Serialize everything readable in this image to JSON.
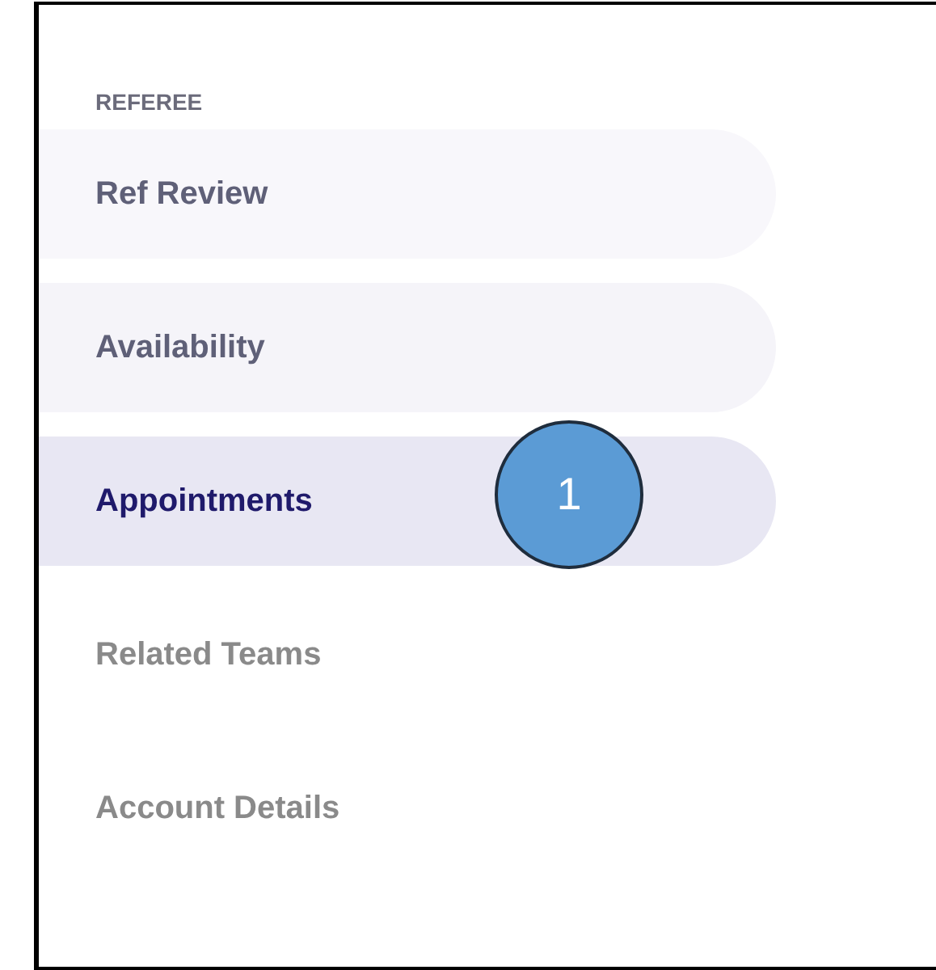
{
  "sidebar": {
    "heading": "REFEREE",
    "items": [
      {
        "label": "Ref Review",
        "kind": "filled",
        "selected": false
      },
      {
        "label": "Availability",
        "kind": "filled",
        "selected": false
      },
      {
        "label": "Appointments",
        "kind": "filled",
        "selected": true,
        "callout": "1"
      },
      {
        "label": "Related Teams",
        "kind": "plain",
        "selected": false
      },
      {
        "label": "Account Details",
        "kind": "plain",
        "selected": false
      }
    ]
  }
}
